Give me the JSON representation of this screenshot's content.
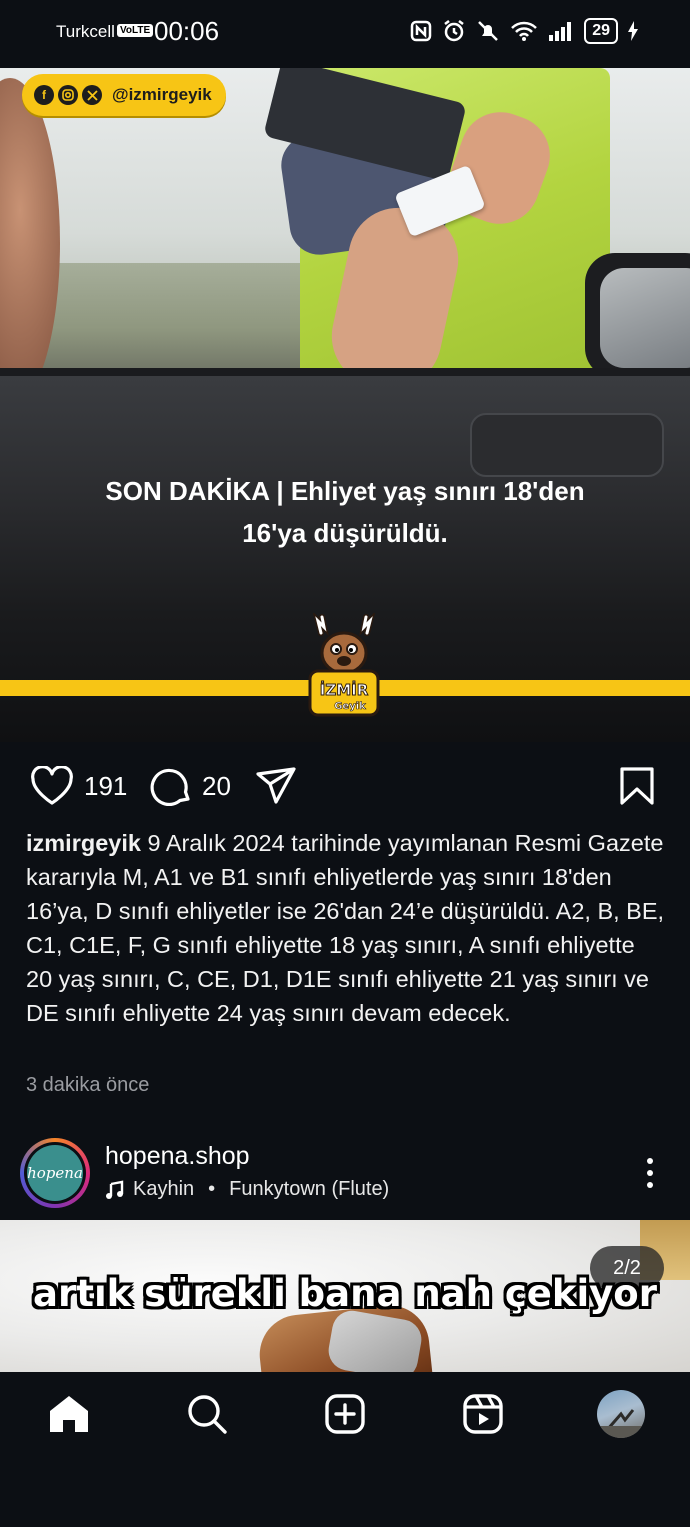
{
  "status_bar": {
    "carrier": "Turkcell",
    "volte": "VoLTE",
    "time": "00:06",
    "battery": "29"
  },
  "post": {
    "account_badge_handle": "@izmirgeyik",
    "headline_line1": "SON DAKİKA | Ehliyet yaş sınırı 18'den",
    "headline_line2": "16'ya düşürüldü.",
    "logo_text_top": "İZMİR",
    "logo_text_bottom": "Geyik",
    "likes": "191",
    "comments": "20",
    "caption_user": "izmirgeyik",
    "caption_text": "9 Aralık 2024 tarihinde yayımlanan Resmi Gazete kararıyla M, A1 ve B1 sınıfı ehliyetlerde yaş sınırı 18'den 16’ya, D sınıfı ehliyetler ise 26'dan 24’e düşürüldü. A2, B, BE, C1, C1E, F, G sınıfı ehliyette 18 yaş sınırı, A sınıfı ehliyette 20 yaş sınırı, C, CE, D1, D1E sınıfı ehliyette 21 yaş sınırı ve DE sınıfı ehliyette 24 yaş sınırı devam edecek.",
    "timestamp": "3 dakika önce"
  },
  "next_post": {
    "avatar_text": "hopena",
    "username": "hopena.shop",
    "music_artist": "Kayhin",
    "separator": "•",
    "music_track": "Funkytown (Flute)",
    "media_caption": "artık sürekli bana nah çekiyor",
    "counter": "2/2"
  },
  "icons": {
    "like": "heart-icon",
    "comment": "comment-icon",
    "share": "send-icon",
    "save": "bookmark-icon",
    "home": "home-icon",
    "search": "search-icon",
    "create": "add-icon",
    "reels": "reels-icon"
  },
  "colors": {
    "background": "#0c0f14",
    "brand_yellow": "#f7c515"
  }
}
